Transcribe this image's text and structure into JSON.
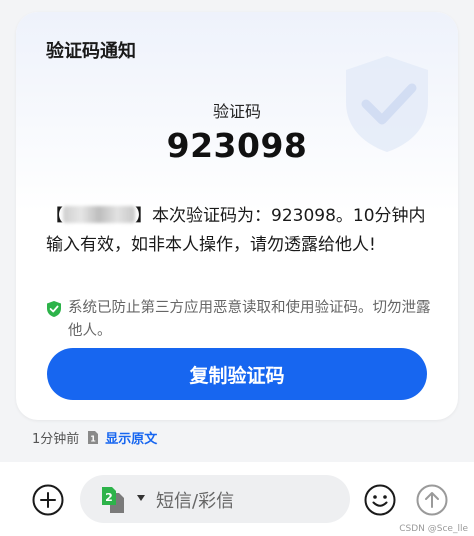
{
  "card": {
    "title": "验证码通知",
    "code_label": "验证码",
    "code_value": "923098",
    "message_prefix": "【",
    "message_body": "】本次验证码为：923098。10分钟内输入有效，如非本人操作，请勿透露给他人!",
    "security_note": "系统已防止第三方应用恶意读取和使用验证码。切勿泄露他人。",
    "copy_button_label": "复制验证码",
    "colors": {
      "accent": "#1766f0",
      "shield": "#2db34a"
    }
  },
  "meta": {
    "time": "1分钟前",
    "sim_badge": "1",
    "view_original_label": "显示原文"
  },
  "input_bar": {
    "sim_icon_number": "2",
    "placeholder": "短信/彩信",
    "icons": [
      "add-icon",
      "sim-card-icon",
      "emoji-icon",
      "send-icon"
    ]
  },
  "watermark": "CSDN @Sce_lle"
}
